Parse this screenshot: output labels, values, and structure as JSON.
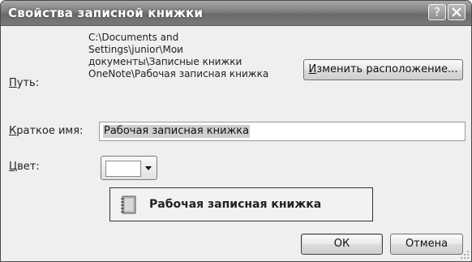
{
  "window": {
    "title": "Свойства записной книжки",
    "help_label": "?"
  },
  "path": {
    "label": "Путь:",
    "label_accel": "П",
    "label_rest": "уть:",
    "value": "C:\\Documents and\nSettings\\junior\\Мои\nдокументы\\Записные книжки\nOneNote\\Рабочая записная книжка",
    "change_button_accel": "И",
    "change_button_rest": "зменить расположение..."
  },
  "short_name": {
    "label_accel": "К",
    "label_rest": "раткое имя:",
    "value": "Рабочая записная книжка"
  },
  "color": {
    "label_accel": "Ц",
    "label_rest": "вет:",
    "selected": "#ffffff"
  },
  "preview": {
    "name": "Рабочая записная книжка",
    "icon": "notebook-icon"
  },
  "buttons": {
    "ok": "ОК",
    "cancel": "Отмена"
  }
}
